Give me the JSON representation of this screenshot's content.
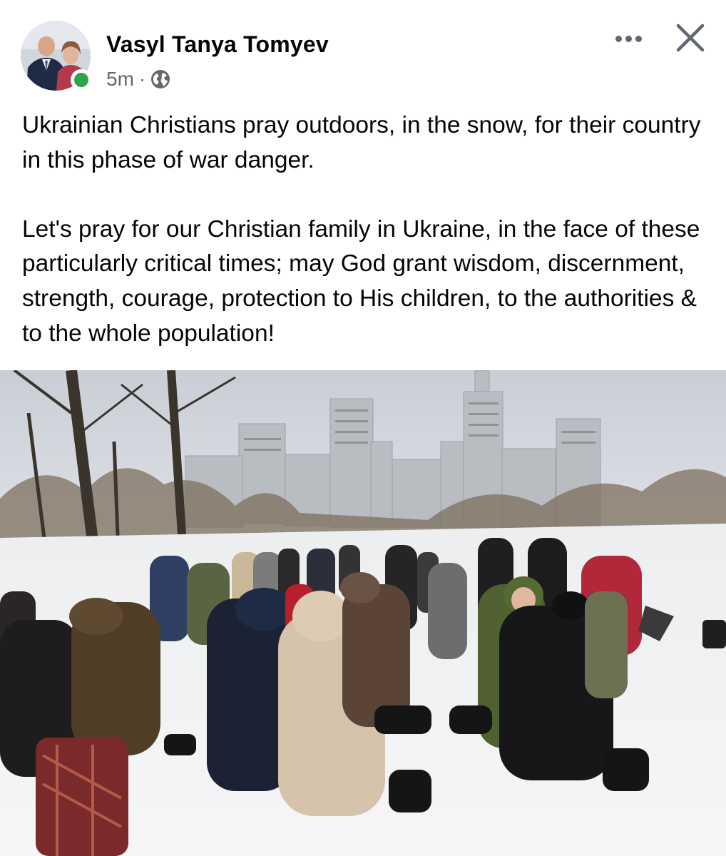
{
  "post": {
    "author": "Vasyl Tanya Tomyev",
    "time": "5m",
    "separator": "·",
    "privacy_icon": "globe-icon",
    "paragraphs": [
      "Ukrainian Christians pray outdoors, in the snow, for their country in this phase of war danger.",
      "Let's pray for our Christian family in Ukraine, in the face of these particularly critical times; may God grant wisdom, discernment, strength, courage, protection to His children, to the authorities & to the whole population!"
    ],
    "online": true
  },
  "header_actions": {
    "more_icon": "more-horizontal-icon",
    "close_icon": "close-icon"
  },
  "colors": {
    "online": "#31a24c",
    "secondary_text": "#65676b",
    "icon": "#606770"
  }
}
